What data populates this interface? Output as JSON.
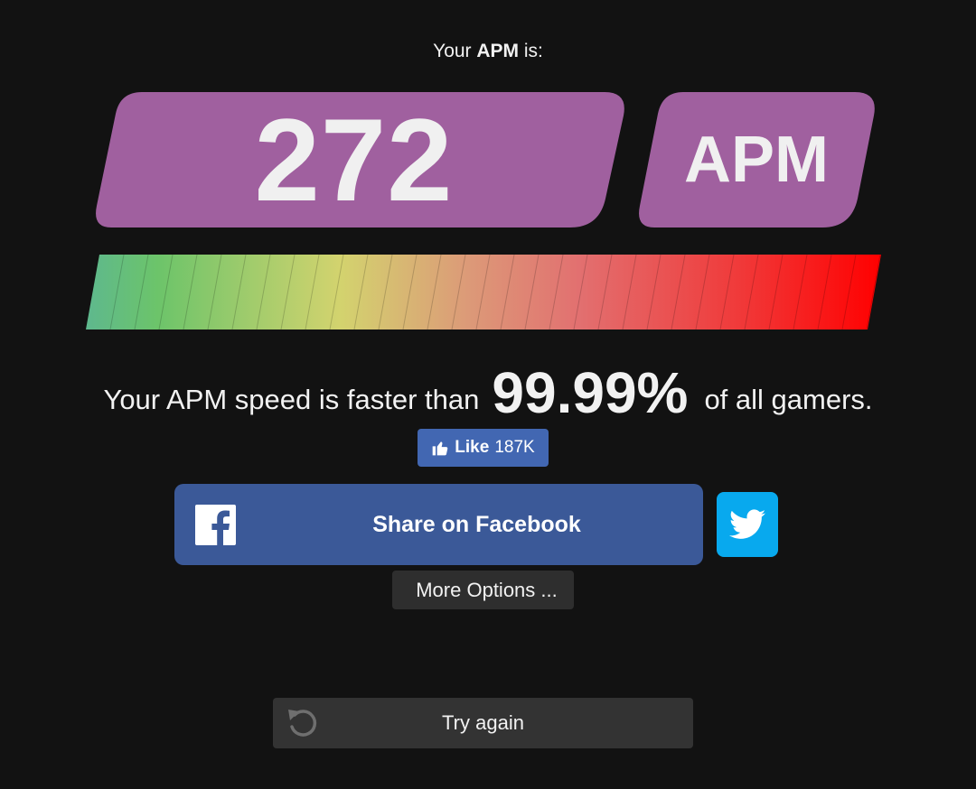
{
  "result": {
    "intro_prefix": "Your ",
    "intro_bold": "APM",
    "intro_suffix": " is:",
    "score": "272",
    "unit": "APM"
  },
  "ranking": {
    "prefix": "Your APM speed is faster than",
    "percent": "99.99%",
    "suffix": "of all gamers."
  },
  "social": {
    "like_label": "Like",
    "like_count": "187K",
    "facebook_share_label": "Share on Facebook",
    "more_options_label": "More Options ..."
  },
  "actions": {
    "try_again_label": "Try again"
  },
  "colors": {
    "accent_purple": "#a0609f",
    "background": "#121212",
    "facebook_blue": "#3b5998",
    "like_blue": "#4267b2",
    "twitter_blue": "#08a9ee",
    "meter_start": "#5eb88e",
    "meter_green": "#6cc46a",
    "meter_yellow": "#d3d36e",
    "meter_salmon": "#e07f74",
    "meter_end": "#ff0000"
  },
  "icons": {
    "like": "thumbs-up-icon",
    "facebook": "facebook-logo-icon",
    "twitter": "twitter-bird-icon",
    "retry": "retry-arrow-icon"
  }
}
